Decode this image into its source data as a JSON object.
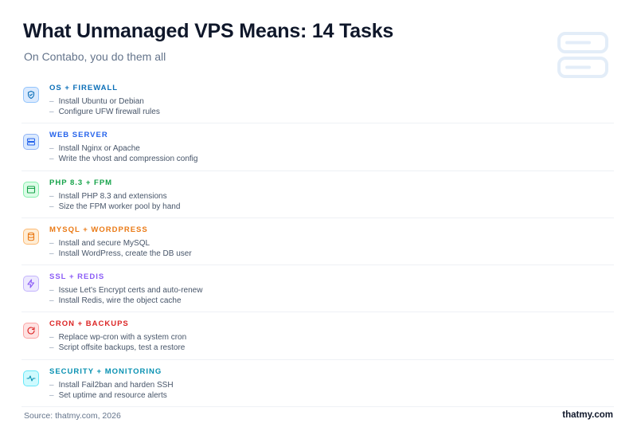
{
  "header": {
    "title": "What Unmanaged VPS Means: 14 Tasks",
    "subtitle": "On Contabo, you do them all"
  },
  "categories": [
    {
      "title": "OS + FIREWALL",
      "icon": "shield-icon",
      "color": "#0b6fb8",
      "icon_bg": "#dbeafe",
      "icon_border": "#93c5fd",
      "items": [
        "Install Ubuntu or Debian",
        "Configure UFW firewall rules"
      ]
    },
    {
      "title": "WEB SERVER",
      "icon": "server-icon",
      "color": "#2563eb",
      "icon_bg": "#dbeafe",
      "icon_border": "#93b4f5",
      "items": [
        "Install Nginx or Apache",
        "Write the vhost and compression config"
      ]
    },
    {
      "title": "PHP 8.3 + FPM",
      "icon": "browser-window-icon",
      "color": "#16a34a",
      "icon_bg": "#dcfce7",
      "icon_border": "#86efac",
      "items": [
        "Install PHP 8.3 and extensions",
        "Size the FPM worker pool by hand"
      ]
    },
    {
      "title": "MYSQL + WORDPRESS",
      "icon": "database-icon",
      "color": "#ea7a16",
      "icon_bg": "#ffedd5",
      "icon_border": "#fdba74",
      "items": [
        "Install and secure MySQL",
        "Install WordPress, create the DB user"
      ]
    },
    {
      "title": "SSL + REDIS",
      "icon": "lightning-icon",
      "color": "#8b5cf6",
      "icon_bg": "#ede9fe",
      "icon_border": "#c4b5fd",
      "items": [
        "Issue Let's Encrypt certs and auto-renew",
        "Install Redis, wire the object cache"
      ]
    },
    {
      "title": "CRON + BACKUPS",
      "icon": "refresh-icon",
      "color": "#dc2626",
      "icon_bg": "#fee2e2",
      "icon_border": "#fca5a5",
      "items": [
        "Replace wp-cron with a system cron",
        "Script offsite backups, test a restore"
      ]
    },
    {
      "title": "SECURITY + MONITORING",
      "icon": "heartbeat-icon",
      "color": "#0891b2",
      "icon_bg": "#cffafe",
      "icon_border": "#67e8f9",
      "items": [
        "Install Fail2ban and harden SSH",
        "Set uptime and resource alerts"
      ]
    }
  ],
  "footer": {
    "source": "Source: thatmy.com, 2026",
    "brand": "thatmy.com"
  },
  "decor": {
    "icon": "server-stack-icon",
    "color": "#e3edf8"
  },
  "dash": "–"
}
